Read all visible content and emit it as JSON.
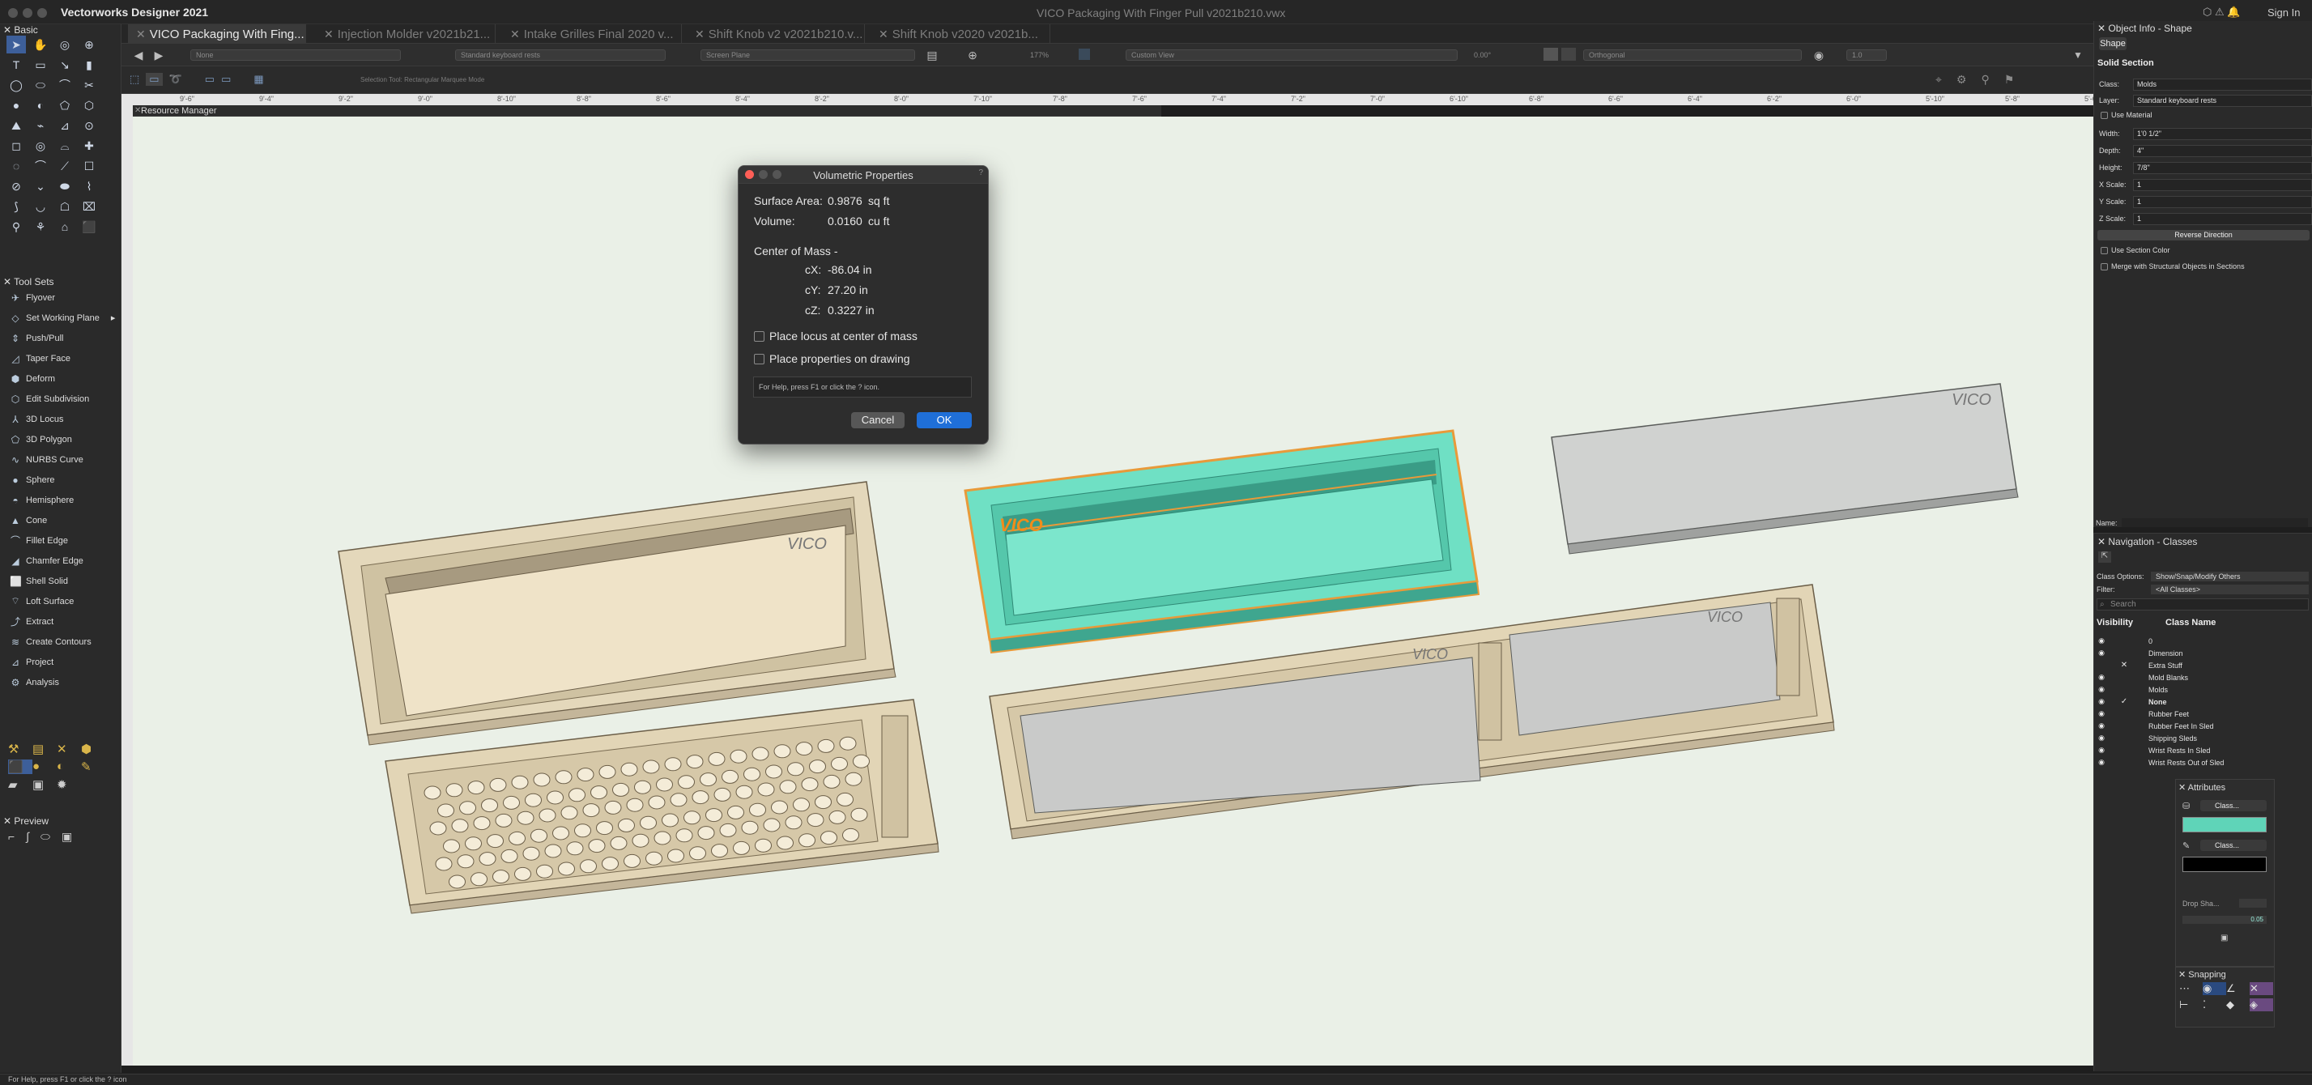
{
  "app": {
    "name": "Vectorworks Designer 2021",
    "window_title": "VICO Packaging With Finger Pull v2021b210.vwx",
    "sign_in": "Sign In"
  },
  "tabs": [
    {
      "label": "VICO Packaging With Fing...",
      "active": true
    },
    {
      "label": "Injection Molder v2021b21...",
      "active": false
    },
    {
      "label": "Intake Grilles Final 2020 v...",
      "active": false
    },
    {
      "label": "Shift Knob v2 v2021b210.v...",
      "active": false
    },
    {
      "label": "Shift Knob v2020 v2021b...",
      "active": false
    }
  ],
  "view_bar": {
    "class_dd": "None",
    "layer_dd": "Standard keyboard rests",
    "plane_dd": "Screen Plane",
    "zoom": "177%",
    "view_dd": "Custom View",
    "angle": "0.00°",
    "projection_dd": "Orthogonal",
    "render_dd": "1.0"
  },
  "mode_bar": {
    "status": "Selection Tool: Rectangular Marquee Mode"
  },
  "ruler_ticks": [
    "9'-6\"",
    "9'-4\"",
    "9'-2\"",
    "9'-0\"",
    "8'-10\"",
    "8'-8\"",
    "8'-6\"",
    "8'-4\"",
    "8'-2\"",
    "8'-0\"",
    "7'-10\"",
    "7'-8\"",
    "7'-6\"",
    "7'-4\"",
    "7'-2\"",
    "7'-0\"",
    "6'-10\"",
    "6'-8\"",
    "6'-6\"",
    "6'-4\"",
    "6'-2\"",
    "6'-0\"",
    "5'-10\"",
    "5'-8\"",
    "5'-6\""
  ],
  "palettes": {
    "basic_title": "Basic",
    "tool_sets_title": "Tool Sets",
    "preview_title": "Preview",
    "resource_manager_title": "Resource Manager"
  },
  "tool_sets": [
    {
      "label": "Flyover",
      "icon": "flyover-icon"
    },
    {
      "label": "Set Working Plane",
      "icon": "working-plane-icon"
    },
    {
      "label": "Push/Pull",
      "icon": "push-pull-icon"
    },
    {
      "label": "Taper Face",
      "icon": "taper-face-icon"
    },
    {
      "label": "Deform",
      "icon": "deform-icon"
    },
    {
      "label": "Edit Subdivision",
      "icon": "subdivision-icon"
    },
    {
      "label": "3D Locus",
      "icon": "locus-icon"
    },
    {
      "label": "3D Polygon",
      "icon": "polygon-3d-icon"
    },
    {
      "label": "NURBS Curve",
      "icon": "nurbs-curve-icon"
    },
    {
      "label": "Sphere",
      "icon": "sphere-icon"
    },
    {
      "label": "Hemisphere",
      "icon": "hemisphere-icon"
    },
    {
      "label": "Cone",
      "icon": "cone-icon"
    },
    {
      "label": "Fillet Edge",
      "icon": "fillet-edge-icon"
    },
    {
      "label": "Chamfer Edge",
      "icon": "chamfer-edge-icon"
    },
    {
      "label": "Shell Solid",
      "icon": "shell-solid-icon"
    },
    {
      "label": "Loft Surface",
      "icon": "loft-surface-icon"
    },
    {
      "label": "Extract",
      "icon": "extract-icon"
    },
    {
      "label": "Create Contours",
      "icon": "contours-icon"
    },
    {
      "label": "Project",
      "icon": "project-icon"
    },
    {
      "label": "Analysis",
      "icon": "analysis-icon"
    }
  ],
  "dialog": {
    "title": "Volumetric Properties",
    "surface_area_label": "Surface Area:",
    "surface_area_value": "0.9876",
    "surface_area_unit": "sq ft",
    "volume_label": "Volume:",
    "volume_value": "0.0160",
    "volume_unit": "cu ft",
    "center_of_mass_label": "Center of Mass -",
    "cx_label": "cX:",
    "cx_value": "-86.04 in",
    "cy_label": "cY:",
    "cy_value": "27.20 in",
    "cz_label": "cZ:",
    "cz_value": "0.3227 in",
    "locus_checkbox_label": "Place locus at center of mass",
    "locus_checked": false,
    "drawing_checkbox_label": "Place properties on drawing",
    "drawing_checked": false,
    "help_text": "For Help, press F1 or click the ? icon.",
    "cancel_label": "Cancel",
    "ok_label": "OK"
  },
  "object_info": {
    "title": "Object Info - Shape",
    "tab": "Shape",
    "section": "Solid Section",
    "class_label": "Class:",
    "class_value": "Molds",
    "layer_label": "Layer:",
    "layer_value": "Standard keyboard rests",
    "use_material": "Use Material",
    "width_label": "Width:",
    "width_value": "1'0 1/2\"",
    "depth_label": "Depth:",
    "depth_value": "4\"",
    "height_label": "Height:",
    "height_value": "7/8\"",
    "xscale_label": "X Scale:",
    "xscale_value": "1",
    "yscale_label": "Y Scale:",
    "yscale_value": "1",
    "zscale_label": "Z Scale:",
    "zscale_value": "1",
    "reverse_direction": "Reverse Direction",
    "use_section_color": "Use Section Color",
    "merge_structural": "Merge with Structural Objects in Sections",
    "name_label": "Name:"
  },
  "navigation": {
    "title": "Navigation - Classes",
    "class_options_label": "Class Options:",
    "class_options_value": "Show/Snap/Modify Others",
    "filter_label": "Filter:",
    "filter_value": "<All Classes>",
    "search_placeholder": "Search",
    "col_visibility": "Visibility",
    "col_class_name": "Class Name",
    "rows": [
      {
        "name": "0",
        "visible": true,
        "mark": ""
      },
      {
        "name": "Dimension",
        "visible": true,
        "mark": ""
      },
      {
        "name": "Extra Stuff",
        "visible": false,
        "mark": "✕"
      },
      {
        "name": "Mold Blanks",
        "visible": true,
        "mark": ""
      },
      {
        "name": "Molds",
        "visible": true,
        "mark": ""
      },
      {
        "name": "None",
        "visible": true,
        "mark": "✓"
      },
      {
        "name": "Rubber Feet",
        "visible": true,
        "mark": ""
      },
      {
        "name": "Rubber Feet In Sled",
        "visible": true,
        "mark": ""
      },
      {
        "name": "Shipping Sleds",
        "visible": true,
        "mark": ""
      },
      {
        "name": "Wrist Rests In Sled",
        "visible": true,
        "mark": ""
      },
      {
        "name": "Wrist Rests Out of Sled",
        "visible": true,
        "mark": ""
      }
    ]
  },
  "attributes": {
    "title": "Attributes",
    "fill_class_label": "Class...",
    "pen_class_label": "Class...",
    "drop_shadow_label": "Drop Sha...",
    "opacity_value": "0.05",
    "fill_color": "#5fd4b8"
  },
  "snapping": {
    "title": "Snapping"
  },
  "status_bar": {
    "help": "For Help, press F1 or click the ? icon"
  },
  "colors": {
    "canvas": "#eaf0e7",
    "selected_fill": "#6fe0c4",
    "selection_outline": "#e89a3a",
    "accent_blue": "#1f6fd8",
    "tan": "#e8dcc0"
  }
}
